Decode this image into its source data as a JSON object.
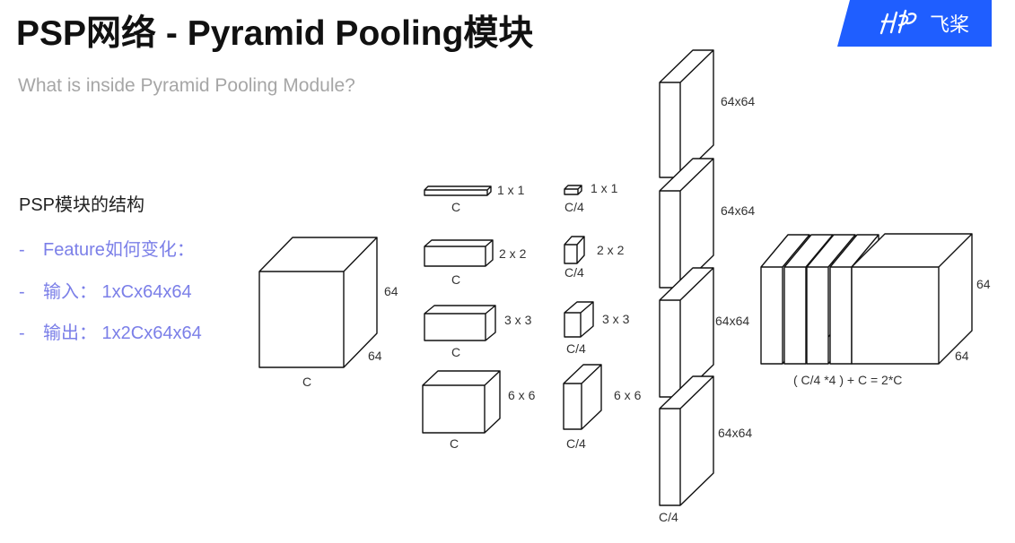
{
  "slide": {
    "title": "PSP网络 - Pyramid Pooling模块",
    "subtitle": "What is inside Pyramid Pooling Module?"
  },
  "logo": {
    "text": "飞桨",
    "brand_color": "#1f5eff"
  },
  "left_panel": {
    "heading": "PSP模块的结构",
    "bullet_color": "#7b7fe8",
    "bullets": [
      {
        "dash": "-",
        "text": "Feature如何变化："
      },
      {
        "dash": "-",
        "text": "输入： 1xCx64x64"
      },
      {
        "dash": "-",
        "text": "输出： 1x2Cx64x64"
      }
    ]
  },
  "diagram": {
    "input": {
      "size_right": "64",
      "size_bottom": "64",
      "channels": "C"
    },
    "pooled": [
      {
        "size": "1 x 1",
        "channels": "C"
      },
      {
        "size": "2 x 2",
        "channels": "C"
      },
      {
        "size": "3 x 3",
        "channels": "C"
      },
      {
        "size": "6 x 6",
        "channels": "C"
      }
    ],
    "reduced": [
      {
        "size": "1 x 1",
        "channels": "C/4"
      },
      {
        "size": "2 x 2",
        "channels": "C/4"
      },
      {
        "size": "3 x 3",
        "channels": "C/4"
      },
      {
        "size": "6 x 6",
        "channels": "C/4"
      }
    ],
    "upsampled": {
      "sizes": [
        "64x64",
        "64x64",
        "64x64",
        "64x64"
      ],
      "channels": "C/4"
    },
    "concat": {
      "size_right": "64",
      "size_bottom": "64",
      "formula": "( C/4 *4 ) + C = 2*C"
    }
  }
}
